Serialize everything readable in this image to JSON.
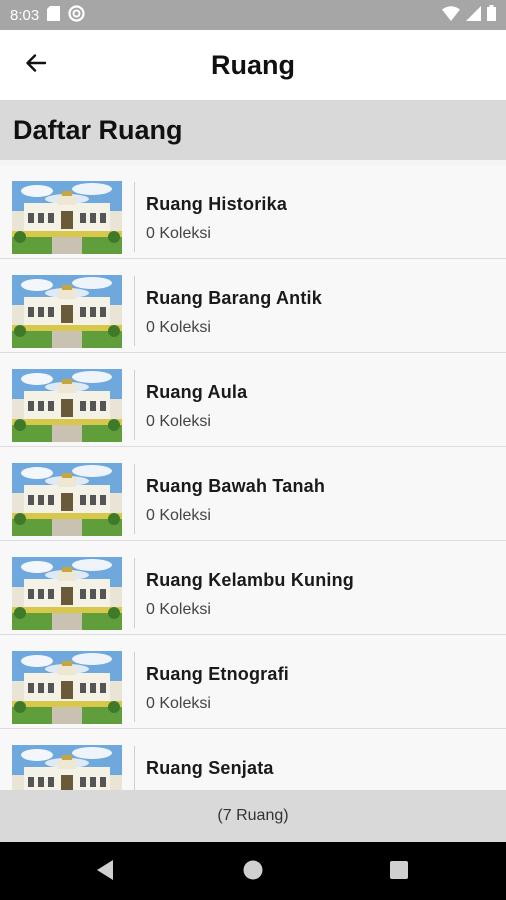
{
  "status_bar": {
    "time": "8:03",
    "icons_left": [
      "sd-card-icon",
      "do-not-disturb-icon"
    ],
    "icons_right": [
      "wifi-icon",
      "signal-icon",
      "battery-icon"
    ]
  },
  "app_bar": {
    "title": "Ruang",
    "back_icon": "arrow-left-icon"
  },
  "section": {
    "title": "Daftar Ruang"
  },
  "rooms": [
    {
      "name": "Ruang Historika",
      "count": "0 Koleksi"
    },
    {
      "name": "Ruang Barang Antik",
      "count": "0 Koleksi"
    },
    {
      "name": "Ruang Aula",
      "count": "0 Koleksi"
    },
    {
      "name": "Ruang Bawah Tanah",
      "count": "0 Koleksi"
    },
    {
      "name": "Ruang Kelambu Kuning",
      "count": "0 Koleksi"
    },
    {
      "name": "Ruang Etnografi",
      "count": "0 Koleksi"
    },
    {
      "name": "Ruang Senjata",
      "count": ""
    }
  ],
  "footer": {
    "summary": "(7 Ruang)"
  },
  "nav_bar": {
    "icons": [
      "back-triangle-icon",
      "home-circle-icon",
      "recents-square-icon"
    ]
  },
  "colors": {
    "status_bar": "#a6a6a6",
    "app_bar": "#ffffff",
    "section_header": "#d9d9d9",
    "list_bg": "#f8f8f8",
    "footer": "#d9d9d9",
    "nav_bar": "#000000"
  }
}
